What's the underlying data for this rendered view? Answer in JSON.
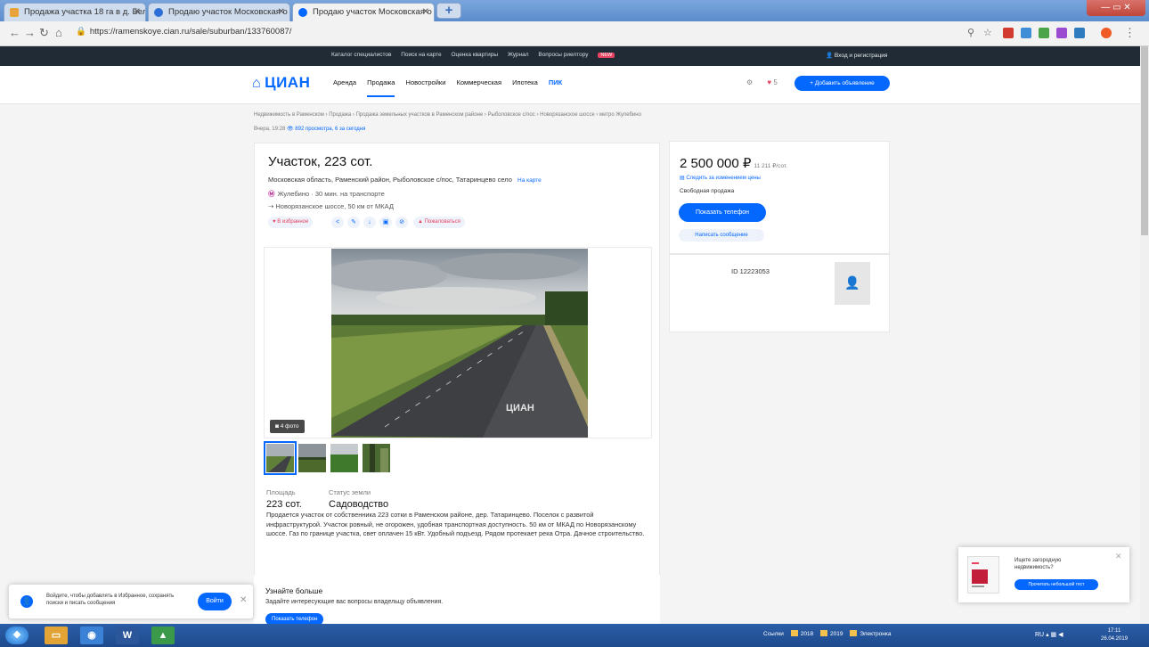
{
  "browser": {
    "tabs": [
      {
        "title": "Продажа участка 18 га в д. Бел"
      },
      {
        "title": "Продаю участок Московская о"
      },
      {
        "title": "Продаю участок Московская о"
      }
    ],
    "url": "https://ramenskoye.cian.ru/sale/suburban/133760087/"
  },
  "site": {
    "top_links": [
      "Каталог специалистов",
      "Поиск на карте",
      "Оценка квартиры",
      "Журнал",
      "Вопросы риелтору"
    ],
    "top_badge": "NEW",
    "login": "Вход и регистрация",
    "logo": "ЦИАН",
    "nav": [
      "Аренда",
      "Продажа",
      "Новостройки",
      "Коммерческая",
      "Ипотека"
    ],
    "nav_pik": "ПИК",
    "favorites_count": "5",
    "add_listing": "+ Добавить объявление"
  },
  "page": {
    "breadcrumb": "Недвижимость в Раменском › Продажа › Продажа земельных участков в Раменском районе › Рыболовское с/пос › Новорязанское шоссе › метро Жулебино",
    "updated": "Вчера, 19:28",
    "views": "892 просмотра, 6 за сегодня",
    "title": "Участок, 223 сот.",
    "address": "Московская область, Раменский район, Рыболовское с/пос, Татаринцево село",
    "on_map": "На карте",
    "metro": "Жулебино",
    "metro_time": "· 30 мин. на транспорте",
    "highway": "Новорязанское шоссе, 50 км от МКАД",
    "actions": {
      "favorite": "В избранное",
      "complain": "Пожаловаться"
    },
    "photo_count": "4 фото",
    "watermark": "ЦИАН",
    "facts": [
      {
        "label": "Площадь",
        "value": "223 сот."
      },
      {
        "label": "Статус земли",
        "value": "Садоводство"
      }
    ],
    "description": "Продается участок от собственника 223 сотки в Раменском районе, дер. Татаринцево. Поселок с развитой инфраструктурой. Участок ровный, не огорожен, удобная транспортная доступность. 50 км от МКАД по Новорязанскому шоссе. Газ по границе участка, свет оплачен 15 кВт. Удобный подъезд. Рядом протекает река Отра. Дачное строительство.",
    "learn_more": {
      "heading": "Узнайте больше",
      "sub": "Задайте интересующие вас вопросы владельцу объявления.",
      "button": "Показать телефон"
    }
  },
  "sidebar": {
    "price": "2 500 000 ₽",
    "price_per": "11 211 ₽/сот.",
    "price_watch": "Следить за изменением цены",
    "sale_type": "Свободная продажа",
    "phone_button": "Показать телефон",
    "message_button": "Написать сообщение",
    "agent_id": "ID 12223053"
  },
  "popups": {
    "login_text": "Войдите, чтобы добавлять в Избранное, сохранять поиски и писать сообщения",
    "login_button": "Войти",
    "ad_text": "Ищете загородную недвижимость?",
    "ad_button": "Прочитать небольшой тест"
  },
  "taskbar": {
    "tray_links": "Ссылки",
    "folders": [
      "2018",
      "2019",
      "Электронка"
    ],
    "lang": "RU",
    "time": "17:11",
    "date": "26.04.2019"
  },
  "colors": {
    "accent": "#0468ff",
    "favorite": "#e84260",
    "metro": "#b2248f",
    "dark_strip": "#202b35"
  }
}
